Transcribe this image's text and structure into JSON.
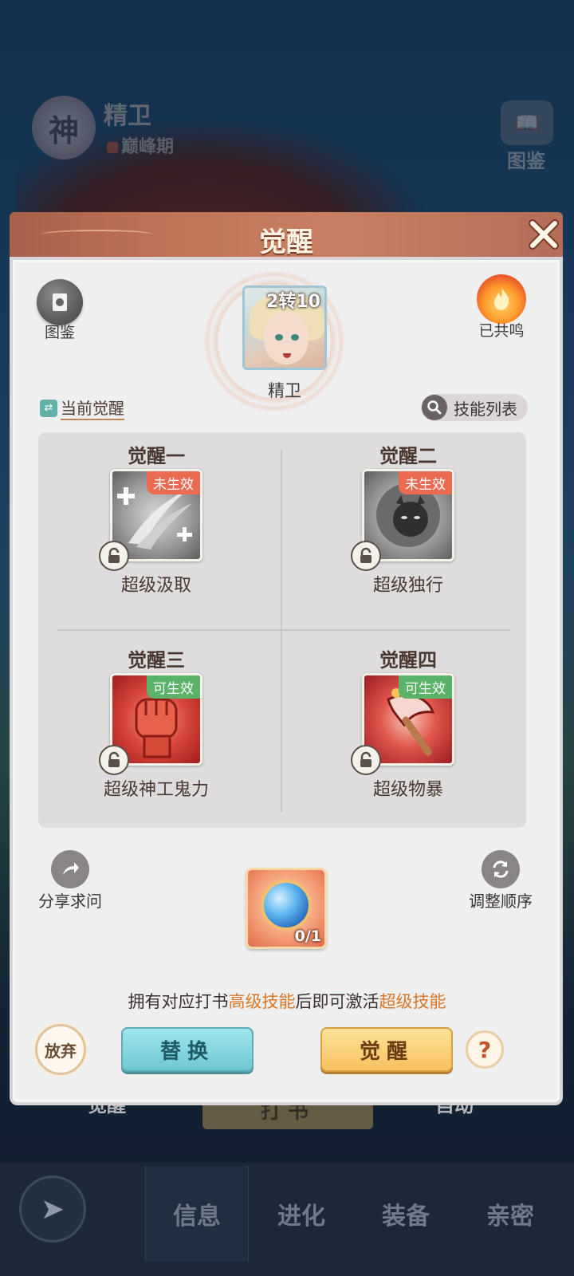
{
  "background": {
    "hero_name": "精卫",
    "hero_stage": "巅峰期",
    "badge_char": "神",
    "dex_label": "图鉴",
    "bottom_left_label": "觉醒",
    "bottom_mid_label": "打书",
    "bottom_right_label": "自动",
    "tabs": [
      "信息",
      "进化",
      "装备",
      "亲密"
    ]
  },
  "modal": {
    "title": "觉醒",
    "dex_label": "图鉴",
    "resonance_label": "已共鸣",
    "hero": {
      "name": "精卫",
      "level": "2转10"
    },
    "current_awaken_label": "当前觉醒",
    "skill_list_label": "技能列表",
    "slots": [
      {
        "title": "觉醒一",
        "skill": "超级汲取",
        "status": "未生效"
      },
      {
        "title": "觉醒二",
        "skill": "超级独行",
        "status": "未生效"
      },
      {
        "title": "觉醒三",
        "skill": "超级神工鬼力",
        "status": "可生效"
      },
      {
        "title": "觉醒四",
        "skill": "超级物暴",
        "status": "可生效"
      }
    ],
    "share_label": "分享求问",
    "reorder_label": "调整顺序",
    "item_count": "0/1",
    "hint": {
      "prefix": "拥有对应打书",
      "highlight1": "高级技能",
      "middle": "后即可激活",
      "highlight2": "超级技能"
    },
    "give_up_label": "放弃",
    "replace_label": "替换",
    "awaken_label": "觉醒",
    "help_label": "?"
  },
  "colors": {
    "accent_orange": "#d9772b",
    "tag_inactive": "#ea6a52",
    "tag_available": "#5bb36a"
  }
}
